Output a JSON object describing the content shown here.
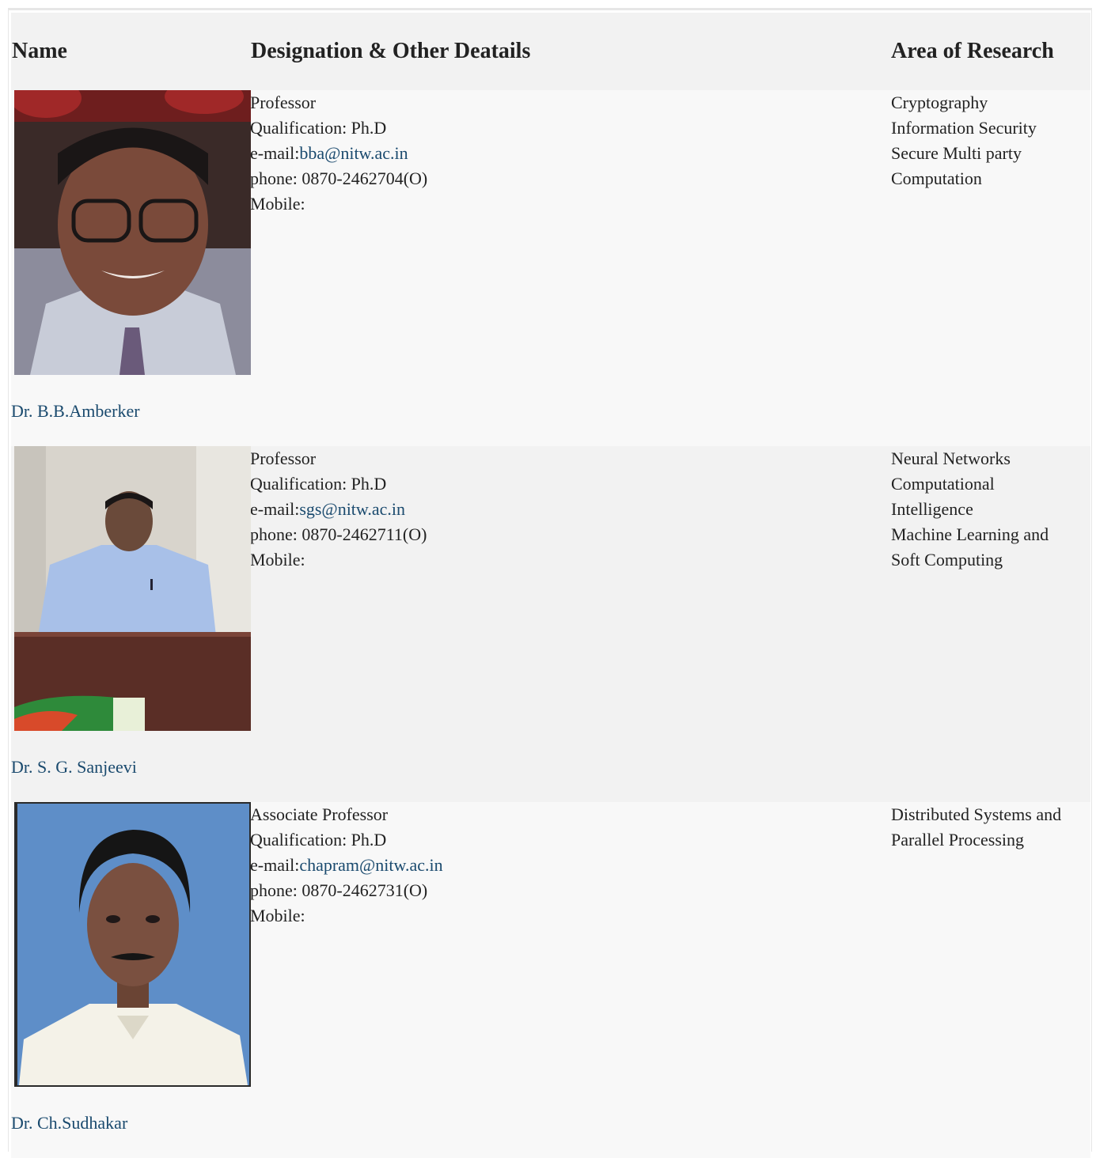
{
  "table": {
    "headers": [
      "Name",
      "Designation & Other Deatails",
      "Area of Research"
    ]
  },
  "faculty": [
    {
      "name": "Dr. B.B.Amberker",
      "designation": "Professor",
      "qualification": "Qualification: Ph.D",
      "email_label": "e-mail:",
      "email": "bba@nitw.ac.in",
      "phone": "phone: 0870-2462704(O)",
      "mobile": "Mobile:",
      "research": [
        "Cryptography",
        "Information Security",
        "Secure Multi party",
        "Computation"
      ]
    },
    {
      "name": "Dr. S. G. Sanjeevi",
      "designation": "Professor",
      "qualification": "Qualification: Ph.D",
      "email_label": "e-mail:",
      "email": "sgs@nitw.ac.in",
      "phone": "phone: 0870-2462711(O)",
      "mobile": "Mobile:",
      "research": [
        "Neural Networks",
        "Computational",
        "Intelligence",
        "Machine Learning and",
        "Soft Computing"
      ]
    },
    {
      "name": "Dr. Ch.Sudhakar",
      "designation": "Associate Professor",
      "qualification": "Qualification: Ph.D",
      "email_label": "e-mail:",
      "email": "chapram@nitw.ac.in",
      "phone": "phone: 0870-2462731(O)",
      "mobile": "Mobile:",
      "research": [
        "Distributed Systems and",
        "Parallel Processing"
      ]
    }
  ],
  "colors": {
    "link": "#1a4a6e",
    "header_bg": "#f2f2f2",
    "row_bg_light": "#f8f8f8",
    "row_bg_dark": "#f2f2f2"
  }
}
